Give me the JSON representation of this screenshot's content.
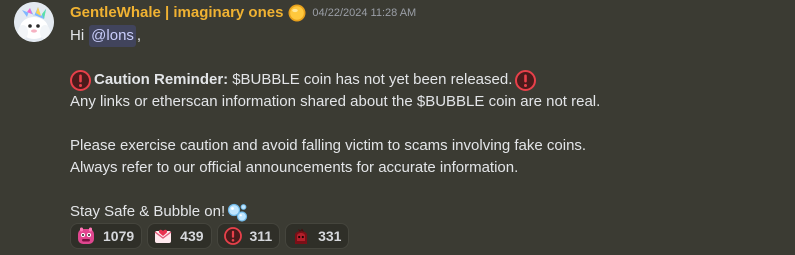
{
  "message": {
    "author": "GentleWhale | imaginary ones",
    "timestamp": "04/22/2024 11:28 AM",
    "role_icon": "gold-coin-icon",
    "avatar": "white-bird-avatar",
    "greeting_prefix": "Hi",
    "mention": "@lons",
    "greeting_suffix": ",",
    "caution_label": "Caution Reminder:",
    "caution_text": "$BUBBLE coin has not yet been released.",
    "line_links": "Any links or etherscan information shared about the $BUBBLE coin are not real.",
    "line_exercise": "Please exercise caution and avoid falling victim to scams involving fake coins.",
    "line_refer": "Always refer to our official announcements for accurate information.",
    "line_closing": "Stay Safe & Bubble on!",
    "colors": {
      "username": "#f0b232",
      "background": "#3b3b33",
      "mention_bg": "#5865f2"
    }
  },
  "reactions": [
    {
      "icon": "pink-monster-emoji",
      "count": "1079"
    },
    {
      "icon": "love-letter-emoji",
      "count": "439"
    },
    {
      "icon": "exclamation-emoji",
      "count": "311"
    },
    {
      "icon": "dark-red-character-emoji",
      "count": "331"
    }
  ]
}
